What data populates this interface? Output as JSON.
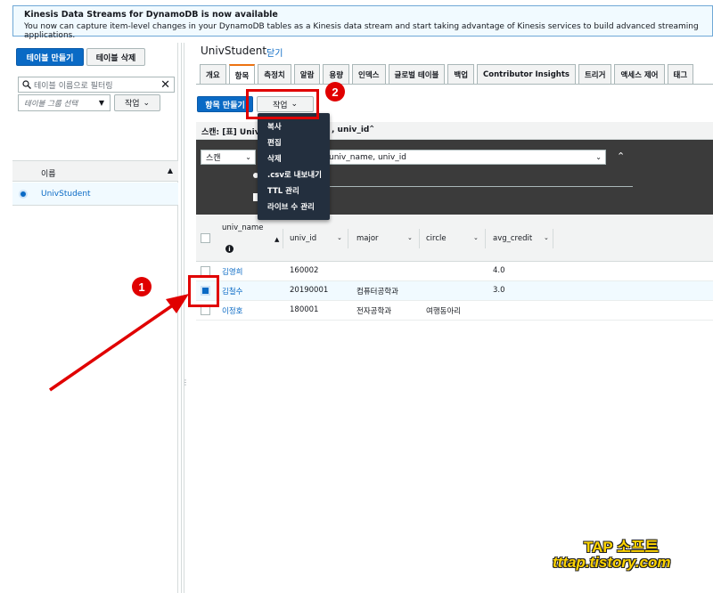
{
  "banner": {
    "title": "Kinesis Data Streams for DynamoDB is now available",
    "text": "You now can capture item-level changes in your DynamoDB tables as a Kinesis data stream and start taking advantage of Kinesis services to build advanced streaming applications."
  },
  "sidebar": {
    "create_table": "테이블 만들기",
    "delete_table": "테이블 삭제",
    "filter_placeholder": "테이블 이름으로 필터링",
    "group_select": "테이블 그룹 선택",
    "action": "작업",
    "column_name": "이름",
    "tables": [
      "UnivStudent"
    ]
  },
  "main": {
    "title": "UnivStudent",
    "close": "닫기",
    "tabs": [
      "개요",
      "항목",
      "측정치",
      "알람",
      "용량",
      "인덱스",
      "글로벌 테이블",
      "백업",
      "Contributor Insights",
      "트리거",
      "액세스 제어",
      "태그"
    ],
    "active_tab": "항목",
    "create_item": "항목 만들기",
    "action": "작업",
    "scan_bar_prefix": "스캔: [표] UnivS",
    "scan_bar_suffix": ", univ_id",
    "scan_mode": "스캔",
    "index_value": "univ_name, univ_id"
  },
  "menu": {
    "items": [
      "복사",
      "편집",
      "삭제",
      ".csv로 내보내기",
      "TTL 관리",
      "라이브 수 관리"
    ]
  },
  "table": {
    "columns": [
      "univ_name",
      "univ_id",
      "major",
      "circle",
      "avg_credit"
    ],
    "rows": [
      {
        "univ_name": "김영희",
        "univ_id": "160002",
        "major": "",
        "circle": "",
        "avg_credit": "4.0",
        "selected": false
      },
      {
        "univ_name": "김철수",
        "univ_id": "20190001",
        "major": "컴퓨터공학과",
        "circle": "",
        "avg_credit": "3.0",
        "selected": true
      },
      {
        "univ_name": "이정호",
        "univ_id": "180001",
        "major": "전자공학과",
        "circle": "여행동아리",
        "avg_credit": "",
        "selected": false
      }
    ]
  },
  "annotations": {
    "badge1": "1",
    "badge2": "2",
    "color": "#e00000"
  },
  "watermark": {
    "line1": "TAP 소프트",
    "line2": "tttap.tistory.com"
  }
}
